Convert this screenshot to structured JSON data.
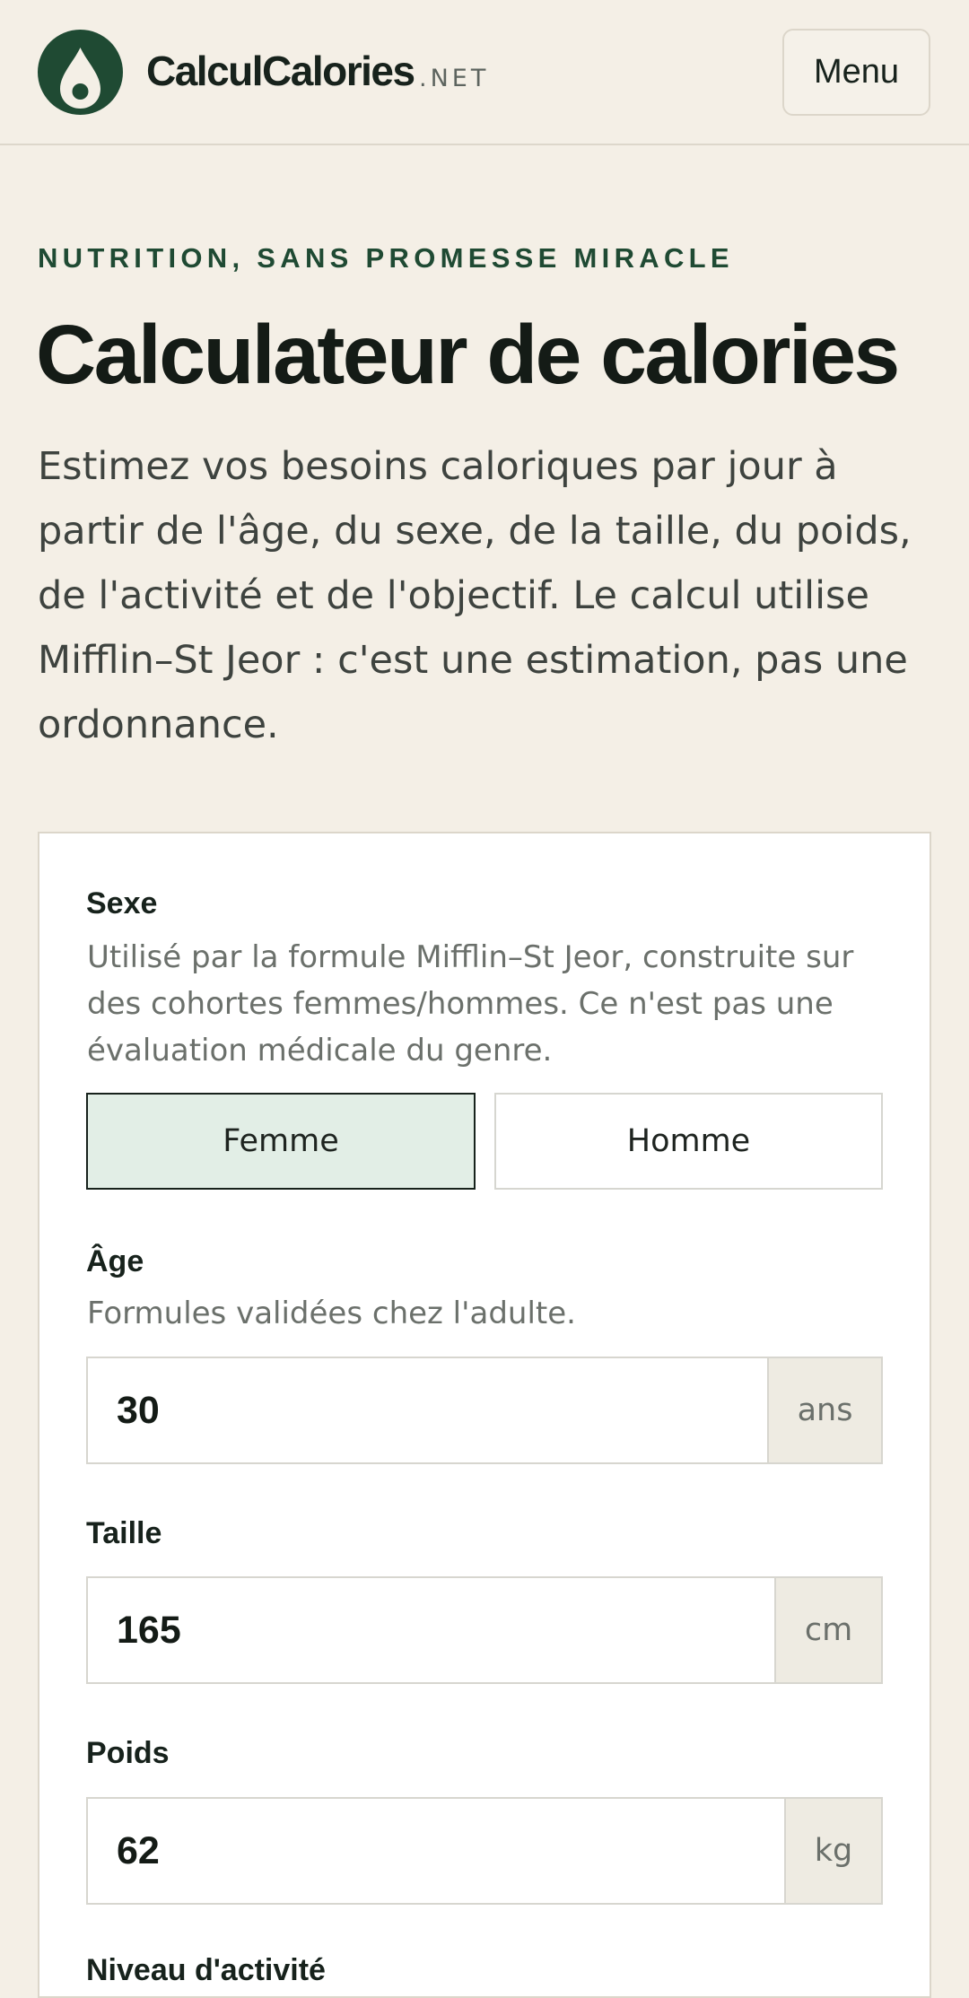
{
  "header": {
    "brand": "CalculCalories",
    "brand_suffix": ".NET",
    "menu_label": "Menu"
  },
  "hero": {
    "eyebrow": "NUTRITION, SANS PROMESSE MIRACLE",
    "title": "Calculateur de calories",
    "lead": "Estimez vos besoins caloriques par jour à partir de l'âge, du sexe, de la taille, du poids, de l'activité et de l'objectif. Le calcul utilise Mifflin–St Jeor : c'est une estimation, pas une ordonnance."
  },
  "form": {
    "sex": {
      "label": "Sexe",
      "help": "Utilisé par la formule Mifflin–St Jeor, construite sur des cohortes femmes/hommes. Ce n'est pas une évaluation médicale du genre.",
      "options": [
        "Femme",
        "Homme"
      ],
      "selected": "Femme"
    },
    "age": {
      "label": "Âge",
      "help": "Formules validées chez l'adulte.",
      "value": "30",
      "unit": "ans"
    },
    "height": {
      "label": "Taille",
      "value": "165",
      "unit": "cm"
    },
    "weight": {
      "label": "Poids",
      "value": "62",
      "unit": "kg"
    },
    "activity": {
      "label": "Niveau d'activité"
    }
  },
  "colors": {
    "background": "#f4efe6",
    "brand_green": "#1f4a33",
    "selected_bg": "#e2eee6"
  },
  "icons": {
    "logo": "drop-icon"
  }
}
